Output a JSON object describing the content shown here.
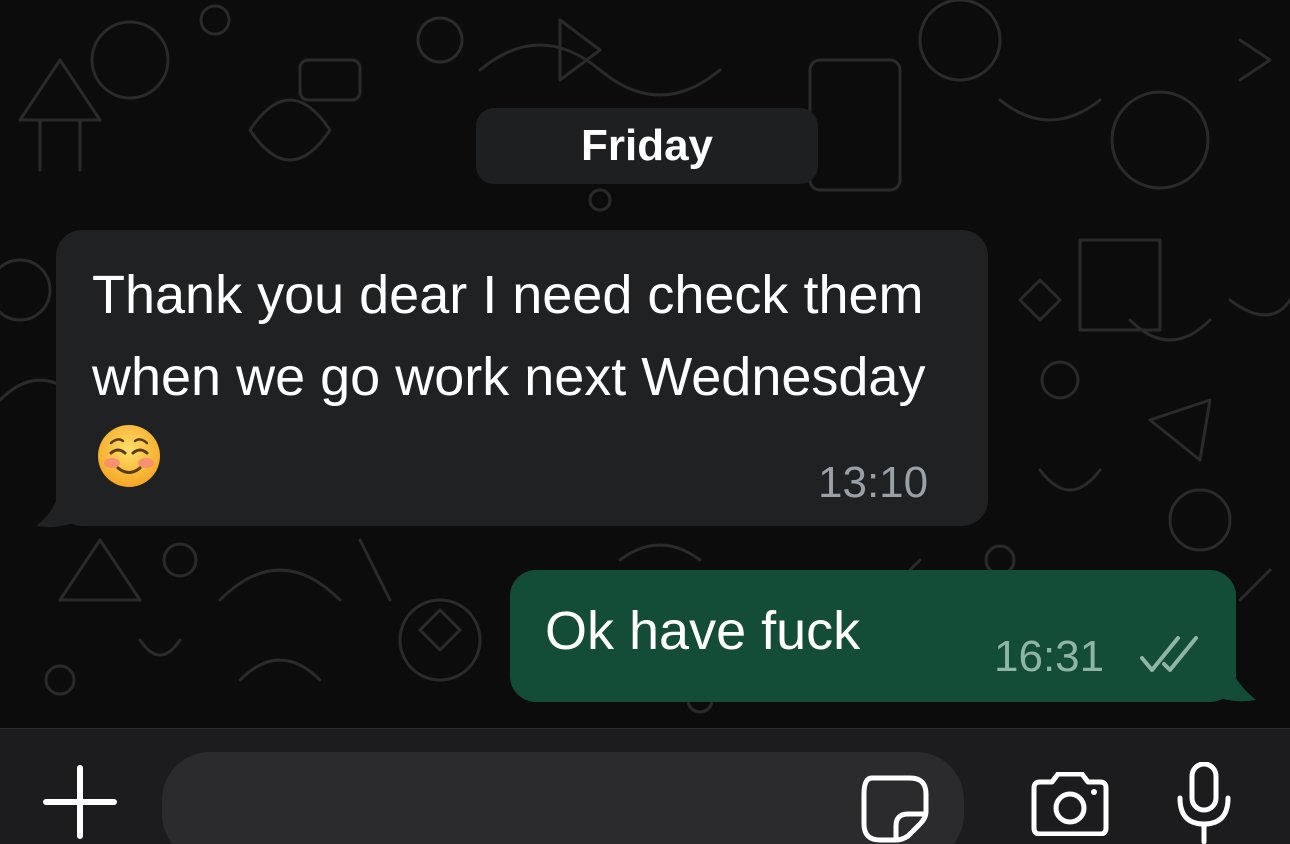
{
  "chat": {
    "date_separator": "Friday",
    "incoming": {
      "text": "Thank you dear I need check them when we go work next Wednesday",
      "emoji": "smiling-face-icon",
      "time": "13:10"
    },
    "outgoing": {
      "text": "Ok have fuck",
      "time": "16:31",
      "status": "read"
    }
  },
  "composer": {
    "placeholder": "",
    "icons": [
      "plus-icon",
      "sticker-icon",
      "camera-icon",
      "microphone-icon"
    ]
  },
  "colors": {
    "background": "#0c0c0c",
    "incoming_bubble": "#1f2123",
    "outgoing_bubble": "#144d37",
    "timestamp_in": "#9aa0a6",
    "timestamp_out": "#8fb5a5",
    "composer_bg": "#1c1c1e"
  }
}
